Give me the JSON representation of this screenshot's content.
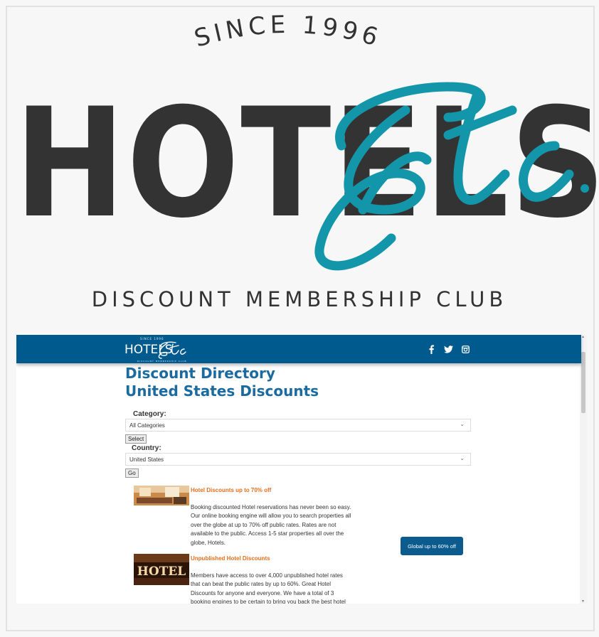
{
  "hero": {
    "since_text": "SINCE 1996",
    "brand_word": "HOTELS",
    "brand_script": "Etc.",
    "tagline": "DISCOUNT MEMBERSHIP CLUB"
  },
  "navbar": {
    "logo_word": "HOTELS",
    "logo_since": "SINCE 1996",
    "logo_club": "DISCOUNT MEMBERSHIP CLUB",
    "social_icons": [
      "facebook-icon",
      "twitter-icon",
      "instagram-icon"
    ]
  },
  "page": {
    "heading": "Discount Directory",
    "subheading": "United States Discounts"
  },
  "filters": {
    "category_label": "Category:",
    "category_value": "All Categories",
    "select_button": "Select",
    "country_label": "Country:",
    "country_value": "United States",
    "go_button": "Go"
  },
  "listings": [
    {
      "title": "Hotel Discounts up to 70% off",
      "description": "Booking discounted Hotel reservations has never been so easy. Our online booking engine will allow you to search properties all over the globe at up to 70% off public rates. Rates are not available to the public. Access 1-5 star properties all over the globe, Hotels."
    },
    {
      "title": "Unpublished Hotel Discounts",
      "description": "Members have access to over 4,000 unpublished hotel rates that can beat the public rates by up to 60%. Great Hotel Discounts for anyone and everyone. We have a total of 3 booking engines to be certain to bring you back the best hotel",
      "thumb_sign": "HOTEL"
    }
  ],
  "global_button": "Global up to 60% off",
  "colors": {
    "navbar": "#005a8e",
    "heading": "#1b6aa0",
    "listing_title": "#e36f1e",
    "brand_script": "#1396a9",
    "brand_dark": "#333333"
  }
}
